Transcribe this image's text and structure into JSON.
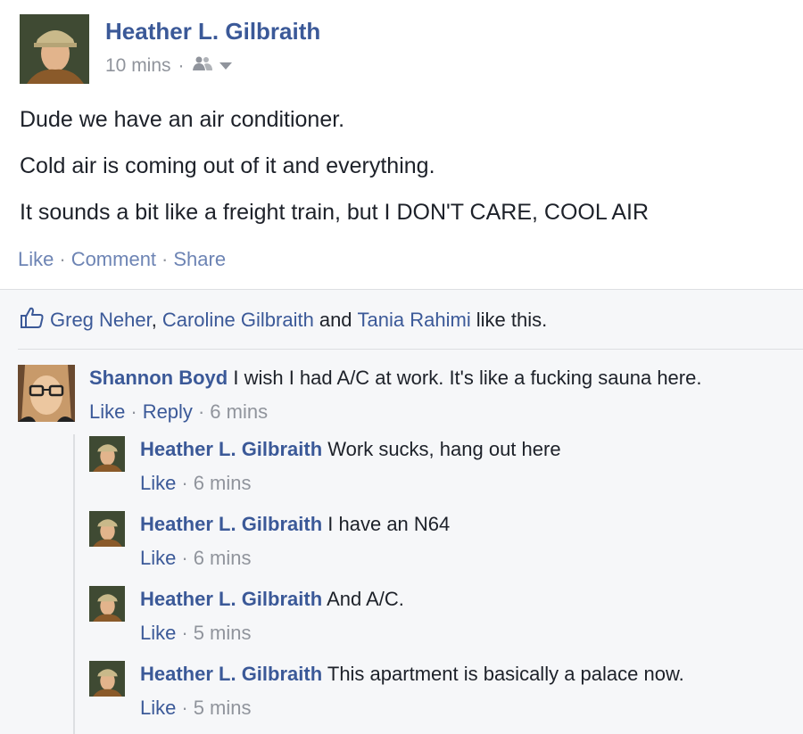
{
  "post": {
    "author": "Heather L. Gilbraith",
    "time": "10 mins",
    "meta_separator": "·",
    "audience_icon": "friends-icon",
    "lines": [
      "Dude we have an air conditioner.",
      "Cold air is coming out of it and everything.",
      "It sounds a bit like a freight train, but I DON'T CARE, COOL AIR"
    ],
    "actions": {
      "like": "Like",
      "comment": "Comment",
      "share": "Share",
      "separator": "·"
    }
  },
  "likes": {
    "icon": "thumbs-up-icon",
    "name1": "Greg Neher",
    "comma": ",",
    "name2": "Caroline Gilbraith",
    "and": "and",
    "name3": "Tania Rahimi",
    "suffix": "like this."
  },
  "comment": {
    "author": "Shannon Boyd",
    "text": "I wish I had A/C at work. It's like a fucking sauna here.",
    "like": "Like",
    "reply": "Reply",
    "time": "6 mins",
    "separator": "·"
  },
  "replies": [
    {
      "author": "Heather L. Gilbraith",
      "text": "Work sucks, hang out here",
      "like": "Like",
      "time": "6 mins",
      "separator": "·"
    },
    {
      "author": "Heather L. Gilbraith",
      "text": "I have an N64",
      "like": "Like",
      "time": "6 mins",
      "separator": "·"
    },
    {
      "author": "Heather L. Gilbraith",
      "text": "And A/C.",
      "like": "Like",
      "time": "5 mins",
      "separator": "·"
    },
    {
      "author": "Heather L. Gilbraith",
      "text": "This apartment is basically a palace now.",
      "like": "Like",
      "time": "5 mins",
      "separator": "·"
    }
  ],
  "colors": {
    "link": "#3b5998",
    "muted_link": "#6d84b4",
    "meta": "#90949c",
    "feedback_bg": "#f6f7f9"
  }
}
